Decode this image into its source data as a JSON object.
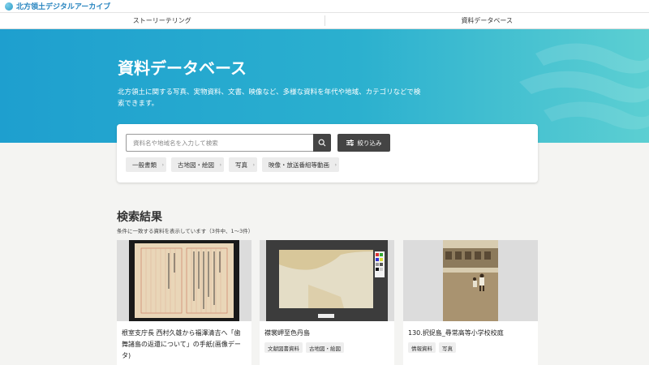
{
  "site": {
    "brand": "北方領土デジタルアーカイブ"
  },
  "nav": {
    "tabs": [
      "ストーリーテリング",
      "資料データベース"
    ]
  },
  "hero": {
    "title": "資料データベース",
    "description": "北方領土に関する写真、実物資料、文書、映像など、多様な資料を年代や地域、カテゴリなどで検索できます。"
  },
  "search": {
    "placeholder": "資料名や地域名を入力して検索",
    "filter_label": "絞り込み",
    "categories": [
      "一般書類",
      "古地図・絵図",
      "写真",
      "映像・放送番組等動画"
    ]
  },
  "results": {
    "title": "検索結果",
    "count_text": "条件に一致する資料を表示しています（3件中、1〜3件）",
    "cards": [
      {
        "title": "根室支庁長 西村久雄から福澤清吉へ「歯舞諸島の返還について」の手紙(画像データ)",
        "tags": []
      },
      {
        "title": "襟裳岬至色丹島",
        "tags": [
          "文献図書資料",
          "古地図・絵図"
        ]
      },
      {
        "title": "130.択捉島_尋常高等小学校校庭",
        "tags": [
          "情報資料",
          "写真"
        ]
      }
    ]
  }
}
